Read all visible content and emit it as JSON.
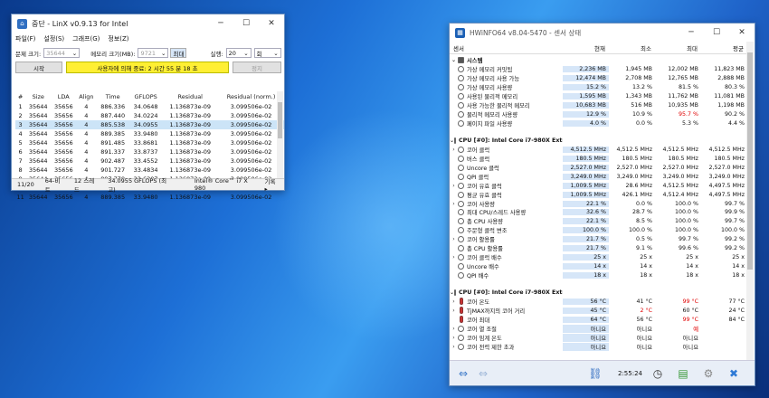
{
  "linx": {
    "title": "중단 - LinX v0.9.13 for Intel",
    "menu": [
      "파일(F)",
      "설정(S)",
      "그래프(G)",
      "정보(Z)"
    ],
    "problem_size_label": "문제 크기:",
    "problem_size_value": "35644",
    "memory_label": "메모리 크기(MB):",
    "memory_value": "9721",
    "max_button": "최대",
    "runs_label": "실행:",
    "runs_value": "20",
    "runs_unit": "회",
    "start_button": "시작",
    "progress_text": "사용자에 의해 중료: 2 시간 55 분 18 초",
    "stop_button": "정지",
    "columns": [
      "#",
      "Size",
      "LDA",
      "Align",
      "Time",
      "GFLOPS",
      "Residual",
      "Residual (norm.)"
    ],
    "rows": [
      [
        "1",
        "35644",
        "35656",
        "4",
        "886.336",
        "34.0648",
        "1.136873e-09",
        "3.099506e-02"
      ],
      [
        "2",
        "35644",
        "35656",
        "4",
        "887.440",
        "34.0224",
        "1.136873e-09",
        "3.099506e-02"
      ],
      [
        "3",
        "35644",
        "35656",
        "4",
        "885.538",
        "34.0955",
        "1.136873e-09",
        "3.099506e-02"
      ],
      [
        "4",
        "35644",
        "35656",
        "4",
        "889.385",
        "33.9480",
        "1.136873e-09",
        "3.099506e-02"
      ],
      [
        "5",
        "35644",
        "35656",
        "4",
        "891.485",
        "33.8681",
        "1.136873e-09",
        "3.099506e-02"
      ],
      [
        "6",
        "35644",
        "35656",
        "4",
        "891.337",
        "33.8737",
        "1.136873e-09",
        "3.099506e-02"
      ],
      [
        "7",
        "35644",
        "35656",
        "4",
        "902.487",
        "33.4552",
        "1.136873e-09",
        "3.099506e-02"
      ],
      [
        "8",
        "35644",
        "35656",
        "4",
        "901.727",
        "33.4834",
        "1.136873e-09",
        "3.099506e-02"
      ],
      [
        "9",
        "35644",
        "35656",
        "4",
        "897.779",
        "33.6307",
        "1.136873e-09",
        "3.099506e-02"
      ],
      [
        "10",
        "35644",
        "35656",
        "4",
        "898.885",
        "33.5893",
        "1.136873e-09",
        "3.099506e-02"
      ],
      [
        "11",
        "35644",
        "35656",
        "4",
        "889.385",
        "33.9480",
        "1.136873e-09",
        "3.099506e-02"
      ]
    ],
    "status": [
      "11/20",
      "64-비트",
      "12 스레드",
      "34.0955 GFLOPS (최고)",
      "Intel® Core™ i7 X 980",
      "기록 ▸"
    ]
  },
  "hwinfo": {
    "title": "HWiNFO64 v8.04-5470 - 센서 상태",
    "columns": [
      "센서",
      "현재",
      "최소",
      "최대",
      "평균"
    ],
    "rows": [
      {
        "type": "group",
        "name": "시스템"
      },
      {
        "name": "가상 메모리 커밋됨",
        "cur": "2,236 MB",
        "min": "1,945 MB",
        "max": "12,002 MB",
        "avg": "11,823 MB"
      },
      {
        "name": "가상 메모리 사용 가능",
        "cur": "12,474 MB",
        "min": "2,708 MB",
        "max": "12,765 MB",
        "avg": "2,888 MB"
      },
      {
        "name": "가상 메모리 사용량",
        "cur": "15.2 %",
        "min": "13.2 %",
        "max": "81.5 %",
        "avg": "80.3 %"
      },
      {
        "name": "사용된 물리적 메모리",
        "cur": "1,595 MB",
        "min": "1,343 MB",
        "max": "11,762 MB",
        "avg": "11,081 MB"
      },
      {
        "name": "사용 가능한 물리적 메모리",
        "cur": "10,683 MB",
        "min": "516 MB",
        "max": "10,935 MB",
        "avg": "1,198 MB"
      },
      {
        "name": "물리적 메모리 사용량",
        "cur": "12.9 %",
        "min": "10.9 %",
        "max": "95.7 %",
        "avg": "90.2 %",
        "max_red": true
      },
      {
        "name": "페이지 파일 사용량",
        "cur": "4.0 %",
        "min": "0.0 %",
        "max": "5.3 %",
        "avg": "4.4 %"
      },
      {
        "type": "blank"
      },
      {
        "type": "group",
        "name": "CPU [#0]: Intel Core i7-980X Extreme Edition"
      },
      {
        "exp": true,
        "name": "코어 클럭",
        "cur": "4,512.5 MHz",
        "min": "4,512.5 MHz",
        "max": "4,512.5 MHz",
        "avg": "4,512.5 MHz"
      },
      {
        "name": "버스 클럭",
        "cur": "180.5 MHz",
        "min": "180.5 MHz",
        "max": "180.5 MHz",
        "avg": "180.5 MHz"
      },
      {
        "name": "Uncore 클럭",
        "cur": "2,527.0 MHz",
        "min": "2,527.0 MHz",
        "max": "2,527.0 MHz",
        "avg": "2,527.0 MHz"
      },
      {
        "name": "QPI 클럭",
        "cur": "3,249.0 MHz",
        "min": "3,249.0 MHz",
        "max": "3,249.0 MHz",
        "avg": "3,249.0 MHz"
      },
      {
        "exp": true,
        "name": "코어 유효 클럭",
        "cur": "1,009.5 MHz",
        "min": "28.6 MHz",
        "max": "4,512.5 MHz",
        "avg": "4,497.5 MHz"
      },
      {
        "name": "평균 유효 클럭",
        "cur": "1,009.5 MHz",
        "min": "426.1 MHz",
        "max": "4,512.4 MHz",
        "avg": "4,497.5 MHz"
      },
      {
        "exp": true,
        "name": "코어 사용량",
        "cur": "22.1 %",
        "min": "0.0 %",
        "max": "100.0 %",
        "avg": "99.7 %"
      },
      {
        "name": "최대 CPU/스레드 사용량",
        "cur": "32.6 %",
        "min": "28.7 %",
        "max": "100.0 %",
        "avg": "99.9 %"
      },
      {
        "name": "총 CPU 사용량",
        "cur": "22.1 %",
        "min": "8.5 %",
        "max": "100.0 %",
        "avg": "99.7 %"
      },
      {
        "name": "주문형 클럭 변조",
        "cur": "100.0 %",
        "min": "100.0 %",
        "max": "100.0 %",
        "avg": "100.0 %"
      },
      {
        "exp": true,
        "name": "코어 활용률",
        "cur": "21.7 %",
        "min": "0.5 %",
        "max": "99.7 %",
        "avg": "99.2 %"
      },
      {
        "name": "총 CPU 활용률",
        "cur": "21.7 %",
        "min": "9.1 %",
        "max": "99.6 %",
        "avg": "99.2 %"
      },
      {
        "exp": true,
        "name": "코어 클럭 배수",
        "cur": "25 x",
        "min": "25 x",
        "max": "25 x",
        "avg": "25 x"
      },
      {
        "name": "Uncore 배수",
        "cur": "14 x",
        "min": "14 x",
        "max": "14 x",
        "avg": "14 x"
      },
      {
        "name": "QPI 배수",
        "cur": "18 x",
        "min": "18 x",
        "max": "18 x",
        "avg": "18 x"
      },
      {
        "type": "blank"
      },
      {
        "type": "group",
        "name": "CPU [#0]: Intel Core i7-980X Extreme Edition: DTS"
      },
      {
        "exp": true,
        "therm": true,
        "name": "코어 온도",
        "cur": "56 °C",
        "min": "41 °C",
        "max": "99 °C",
        "avg": "77 °C",
        "max_red": true
      },
      {
        "exp": true,
        "therm": true,
        "name": "TjMAX까지의 코어 거리",
        "cur": "45 °C",
        "min": "2 °C",
        "max": "60 °C",
        "avg": "24 °C",
        "min_red": true
      },
      {
        "therm": true,
        "name": "코어 최대",
        "cur": "64 °C",
        "min": "56 °C",
        "max": "99 °C",
        "avg": "84 °C",
        "max_red": true
      },
      {
        "exp": true,
        "name": "코어 열 조절",
        "cur": "아니요",
        "min": "아니요",
        "max": "예",
        "avg": "",
        "max_red": true
      },
      {
        "exp": true,
        "name": "코어 임계 온도",
        "cur": "아니요",
        "min": "아니요",
        "max": "아니요",
        "avg": ""
      },
      {
        "exp": true,
        "name": "코어 전력 제한 초과",
        "cur": "아니요",
        "min": "아니요",
        "max": "아니요",
        "avg": ""
      }
    ],
    "time": "2:55:24"
  }
}
